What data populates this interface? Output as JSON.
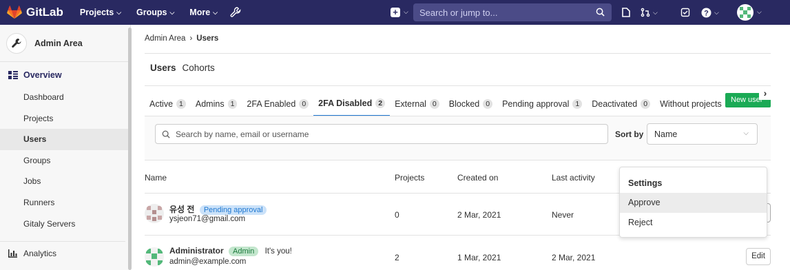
{
  "topbar": {
    "brand": "GitLab",
    "nav": [
      {
        "label": "Projects"
      },
      {
        "label": "Groups"
      },
      {
        "label": "More"
      }
    ],
    "search_placeholder": "Search or jump to..."
  },
  "sidebar": {
    "title": "Admin Area",
    "section": "Overview",
    "items": [
      {
        "label": "Dashboard"
      },
      {
        "label": "Projects"
      },
      {
        "label": "Users"
      },
      {
        "label": "Groups"
      },
      {
        "label": "Jobs"
      },
      {
        "label": "Runners"
      },
      {
        "label": "Gitaly Servers"
      }
    ],
    "analytics": "Analytics"
  },
  "breadcrumb": {
    "root": "Admin Area",
    "separator": "›",
    "current": "Users"
  },
  "top_tabs": [
    {
      "label": "Users"
    },
    {
      "label": "Cohorts"
    }
  ],
  "filter_tabs": [
    {
      "label": "Active",
      "count": "1"
    },
    {
      "label": "Admins",
      "count": "1"
    },
    {
      "label": "2FA Enabled",
      "count": "0"
    },
    {
      "label": "2FA Disabled",
      "count": "2"
    },
    {
      "label": "External",
      "count": "0"
    },
    {
      "label": "Blocked",
      "count": "0"
    },
    {
      "label": "Pending approval",
      "count": "1"
    },
    {
      "label": "Deactivated",
      "count": "0"
    },
    {
      "label": "Without projects",
      "count": ""
    }
  ],
  "new_user_button": "New user",
  "filter": {
    "search_placeholder": "Search by name, email or username",
    "sort_label": "Sort by",
    "sort_value": "Name"
  },
  "table": {
    "headers": {
      "name": "Name",
      "projects": "Projects",
      "created": "Created on",
      "last_activity": "Last activity"
    },
    "rows": [
      {
        "name": "유성 전",
        "badge": "Pending approval",
        "email": "ysjeon71@gmail.com",
        "projects": "0",
        "created": "2 Mar, 2021",
        "last_activity": "Never"
      },
      {
        "name": "Administrator",
        "badge": "Admin",
        "note": "It's you!",
        "email": "admin@example.com",
        "projects": "2",
        "created": "1 Mar, 2021",
        "last_activity": "2 Mar, 2021",
        "action": "Edit"
      }
    ]
  },
  "dropdown": {
    "header": "Settings",
    "items": [
      {
        "label": "Approve"
      },
      {
        "label": "Reject"
      }
    ]
  },
  "colors": {
    "topbar": "#292961",
    "accent": "#1f78d1",
    "new_user": "#1aaa55"
  }
}
